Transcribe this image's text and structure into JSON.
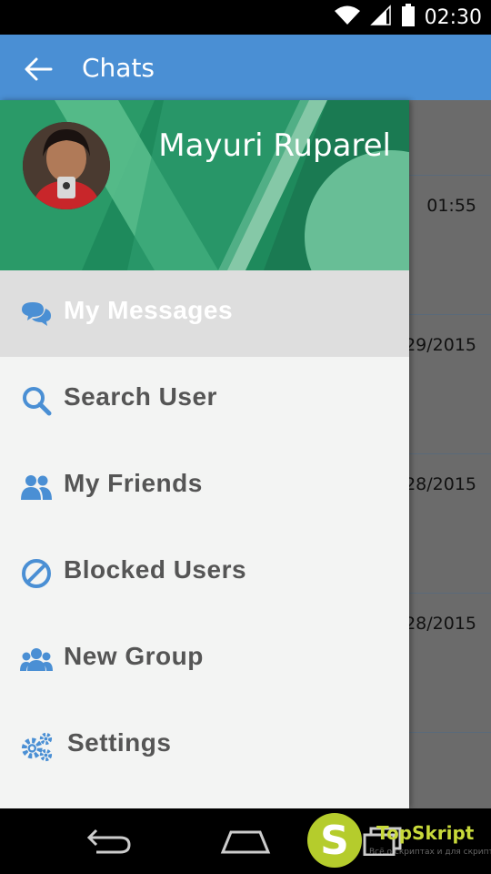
{
  "status_bar": {
    "time": "02:30",
    "icons": [
      "wifi-icon",
      "signal-icon",
      "battery-icon"
    ]
  },
  "app_bar": {
    "title": "Chats",
    "back_icon": "arrow-left-icon"
  },
  "background_list": {
    "times": [
      "01:55",
      "29/2015",
      "28/2015",
      "28/2015"
    ]
  },
  "drawer": {
    "user_name": "Mayuri Ruparel",
    "items": [
      {
        "label": "My Messages",
        "icon": "chat-bubbles-icon",
        "active": true
      },
      {
        "label": "Search User",
        "icon": "search-icon",
        "active": false
      },
      {
        "label": "My Friends",
        "icon": "friends-icon",
        "active": false
      },
      {
        "label": "Blocked Users",
        "icon": "blocked-icon",
        "active": false
      },
      {
        "label": "New Group",
        "icon": "group-icon",
        "active": false
      },
      {
        "label": "Settings",
        "icon": "gears-icon",
        "active": false
      }
    ]
  },
  "watermark": {
    "letter": "S",
    "brand": "TopSkript",
    "tagline": "Всё о скриптах и для скриптов..."
  },
  "colors": {
    "accent": "#4a8fd4",
    "header_green": "#1f8a5e",
    "drawer_bg": "#f3f4f3",
    "icon_blue": "#4a8fd4"
  }
}
